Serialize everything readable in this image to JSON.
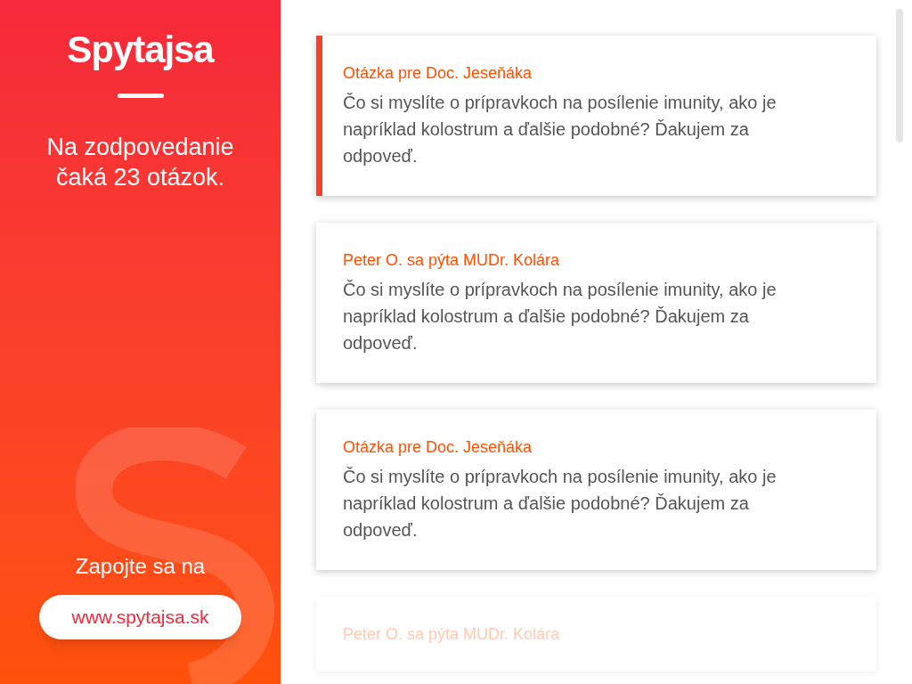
{
  "sidebar": {
    "logo": "Spytajsa",
    "waiting_text": "Na zodpovedanie čaká 23 otázok.",
    "join_text": "Zapojte sa na",
    "link": "www.spytajsa.sk"
  },
  "questions": [
    {
      "title": "Otázka pre Doc. Jeseňáka",
      "body": "Čo si myslíte o prípravkoch na posílenie imunity, ako je napríklad kolostrum a ďalšie podobné? Ďakujem za odpoveď.",
      "selected": true,
      "faded": false
    },
    {
      "title": "Peter O. sa pýta MUDr. Kolára",
      "body": "Čo si myslíte o prípravkoch na posílenie imunity, ako je napríklad kolostrum a ďalšie podobné? Ďakujem za odpoveď.",
      "selected": false,
      "faded": false
    },
    {
      "title": "Otázka pre Doc. Jeseňáka",
      "body": "Čo si myslíte o prípravkoch na posílenie imunity, ako je napríklad kolostrum a ďalšie podobné? Ďakujem za odpoveď.",
      "selected": false,
      "faded": false
    },
    {
      "title": "Peter O. sa pýta MUDr. Kolára",
      "selected": false,
      "faded": true
    }
  ]
}
